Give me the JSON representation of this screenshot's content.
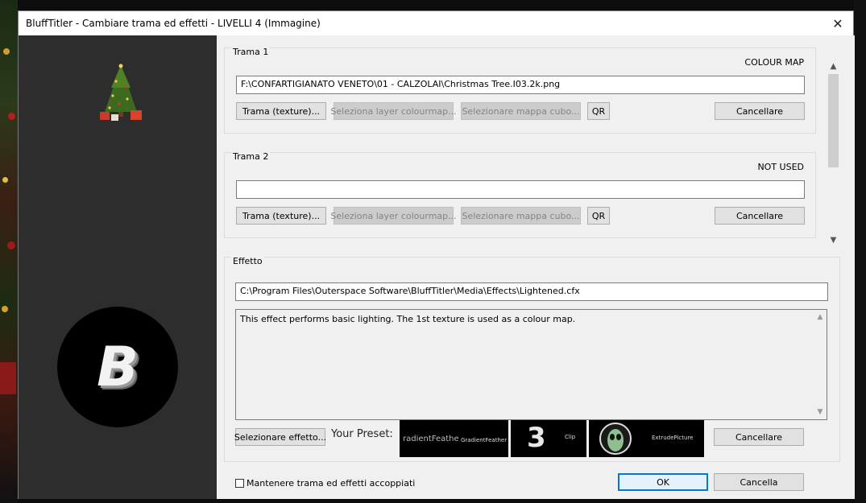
{
  "window": {
    "title": "BluffTitler - Cambiare trama ed effetti - LIVELLI 4 (Immagine)",
    "close_icon": "close-icon"
  },
  "preview": {
    "logo_letter": "B"
  },
  "texture1": {
    "label": "Trama 1",
    "tag": "COLOUR MAP",
    "path": "F:\\CONFARTIGIANATO VENETO\\01 - CALZOLAI\\Christmas Tree.I03.2k.png",
    "btn_texture": "Trama (texture)...",
    "btn_colourmap": "Seleziona layer colourmap...",
    "btn_cubemap": "Selezionare mappa cubo...",
    "btn_qr": "QR",
    "btn_cancel": "Cancellare"
  },
  "texture2": {
    "label": "Trama 2",
    "tag": "NOT USED",
    "path": "",
    "btn_texture": "Trama (texture)...",
    "btn_colourmap": "Seleziona layer colourmap...",
    "btn_cubemap": "Selezionare mappa cubo...",
    "btn_qr": "QR",
    "btn_cancel": "Cancellare"
  },
  "effect": {
    "label": "Effetto",
    "path": "C:\\Program Files\\Outerspace Software\\BluffTitler\\Media\\Effects\\Lightened.cfx",
    "description": "This effect performs basic lighting. The 1st texture is used as a colour map.",
    "btn_select": "Selezionare effetto...",
    "preset_label": "Your Preset:",
    "presets": [
      {
        "big": "radientFeathe",
        "small": "GradientFeather"
      },
      {
        "big": "3",
        "small": "Clip"
      },
      {
        "big": "",
        "small": "ExtrudePicture"
      }
    ],
    "btn_cancel": "Cancellare"
  },
  "footer": {
    "keep_label": "Mantenere trama ed effetti accoppiati",
    "ok": "OK",
    "cancel": "Cancella"
  }
}
